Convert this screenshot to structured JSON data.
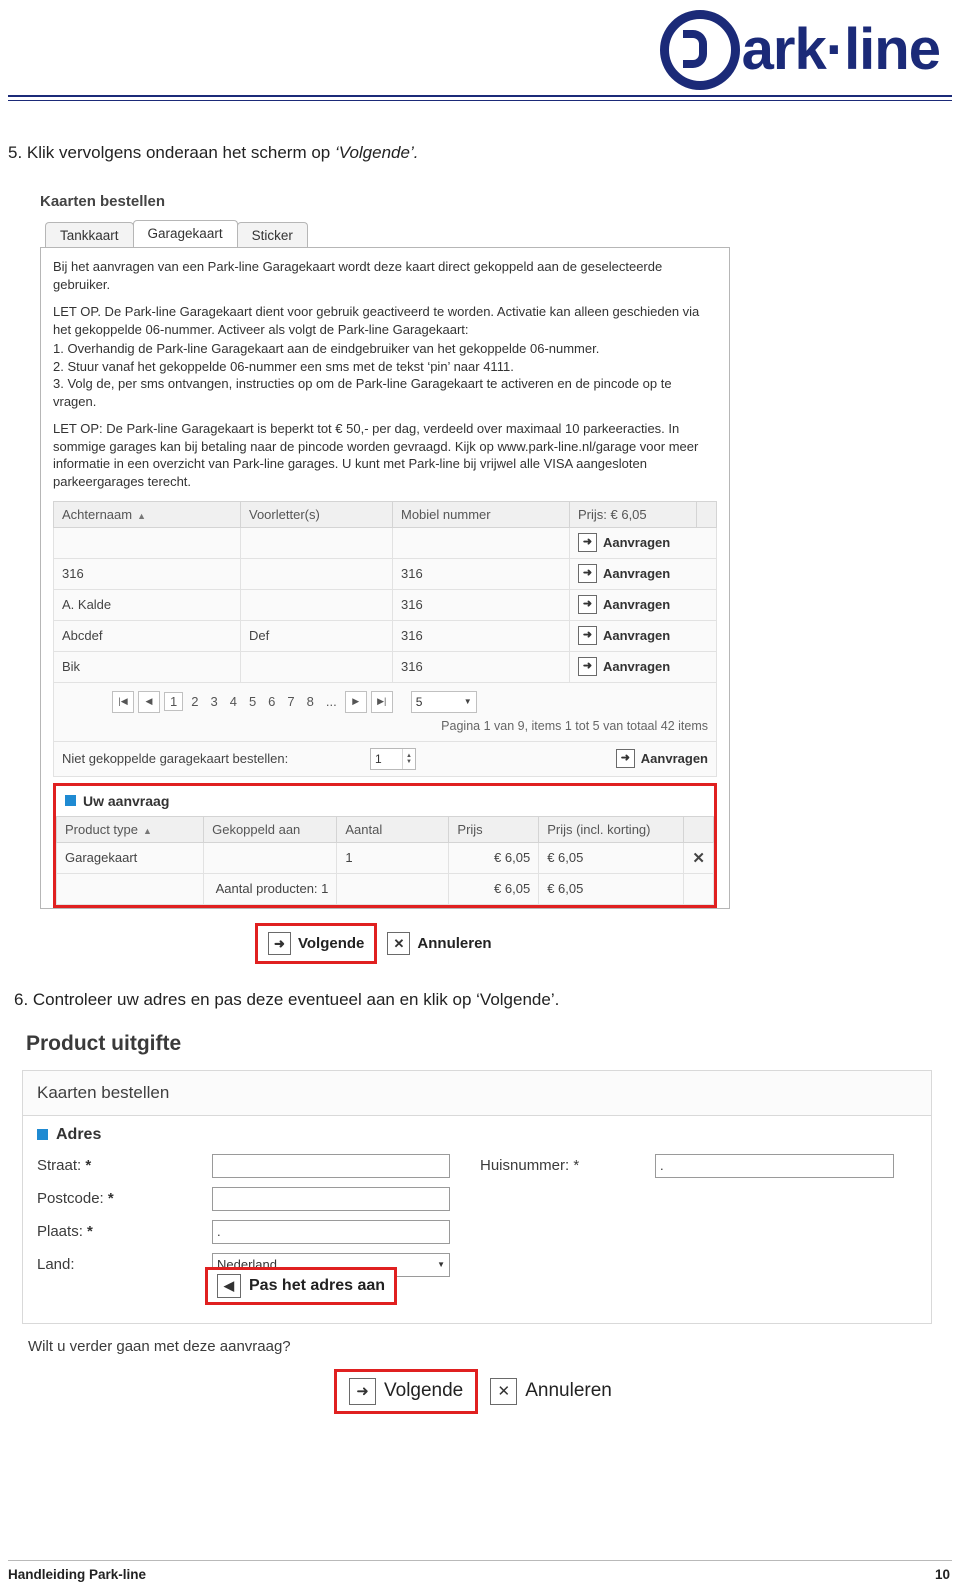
{
  "header": {
    "logo_text": "ark·line",
    "logo_letter": "P"
  },
  "steps": {
    "step5": "5. Klik vervolgens onderaan het scherm op ",
    "step5_italic": "‘Volgende’.",
    "step6": "6. Controleer uw adres en pas deze eventueel aan en klik op ",
    "step6_italic": "‘Volgende’."
  },
  "shot1": {
    "title": "Kaarten bestellen",
    "tabs": [
      {
        "label": "Tankkaart",
        "active": false
      },
      {
        "label": "Garagekaart",
        "active": true
      },
      {
        "label": "Sticker",
        "active": false
      }
    ],
    "paragraphs": [
      "Bij het aanvragen van een Park-line Garagekaart wordt deze kaart direct gekoppeld aan de geselecteerde gebruiker.",
      "LET OP. De Park-line Garagekaart dient voor gebruik geactiveerd te worden. Activatie kan alleen geschieden via het gekoppelde 06-nummer. Activeer als volgt de Park-line Garagekaart:"
    ],
    "numbered": [
      "1. Overhandig de Park-line Garagekaart aan de eindgebruiker van het gekoppelde 06-nummer.",
      "2. Stuur vanaf het gekoppelde 06-nummer een sms met de tekst ‘pin’ naar 4111.",
      "3. Volg de, per sms ontvangen, instructies op om de Park-line Garagekaart te activeren en de pincode op te vragen."
    ],
    "paragraph_last": "LET OP: De Park-line Garagekaart is beperkt tot € 50,- per dag, verdeeld over maximaal 10 parkeeracties. In sommige garages kan bij betaling naar de pincode worden gevraagd. Kijk op www.park-line.nl/garage voor meer informatie in een overzicht van Park-line garages. U kunt met Park-line bij vrijwel alle VISA aangesloten parkeergarages terecht.",
    "table": {
      "headers": [
        "Achternaam",
        "Voorletter(s)",
        "Mobiel nummer",
        "Prijs: € 6,05",
        ""
      ],
      "sort_column": "Achternaam",
      "rows": [
        {
          "achternaam": "",
          "voorletters": "",
          "mobiel": "",
          "action": "Aanvragen"
        },
        {
          "achternaam": "316",
          "voorletters": "",
          "mobiel": "316",
          "action": "Aanvragen"
        },
        {
          "achternaam": "A. Kaldе",
          "voorletters": "",
          "mobiel": "316",
          "action": "Aanvragen"
        },
        {
          "achternaam": "Abcdef",
          "voorletters": "Def",
          "mobiel": "316",
          "action": "Aanvragen"
        },
        {
          "achternaam": "Bik",
          "voorletters": "",
          "mobiel": "316",
          "action": "Aanvragen"
        }
      ]
    },
    "pager": {
      "first": "|◀",
      "prev": "◀",
      "pages": [
        "1",
        "2",
        "3",
        "4",
        "5",
        "6",
        "7",
        "8",
        "..."
      ],
      "current_page": "1",
      "next": "▶",
      "last": "▶|",
      "page_size": "5",
      "info": "Pagina 1 van 9, items 1 tot 5 van totaal 42 items"
    },
    "niet_gekoppeld": {
      "label": "Niet gekoppelde garagekaart bestellen:",
      "quantity": "1",
      "action": "Aanvragen"
    },
    "aanvraag": {
      "title": "Uw aanvraag",
      "headers": [
        "Product type",
        "Gekoppeld aan",
        "Aantal",
        "Prijs",
        "Prijs (incl. korting)",
        ""
      ],
      "row": {
        "product": "Garagekaart",
        "gekoppeld": "",
        "aantal": "1",
        "prijs": "€ 6,05",
        "prijs_korting": "€ 6,05",
        "remove": "✕"
      },
      "total": {
        "label": "Aantal producten: 1",
        "prijs": "€ 6,05",
        "prijs_korting": "€ 6,05"
      }
    },
    "buttons": {
      "next": "Volgende",
      "cancel": "Annuleren"
    }
  },
  "shot2": {
    "title": "Product uitgifte",
    "bar": "Kaarten bestellen",
    "section": "Adres",
    "fields": {
      "straat_label": "Straat:",
      "straat_value": "",
      "huisnummer_label": "Huisnummer:",
      "huisnummer_value": ".",
      "postcode_label": "Postcode:",
      "postcode_value": "",
      "plaats_label": "Plaats:",
      "plaats_value": ".",
      "land_label": "Land:",
      "land_value": "Nederland"
    },
    "adjust_button": "Pas het adres aan",
    "question": "Wilt u verder gaan met deze aanvraag?",
    "buttons": {
      "next": "Volgende",
      "cancel": "Annuleren"
    }
  },
  "footer": {
    "left": "Handleiding Park-line",
    "right": "10"
  },
  "colors": {
    "brand": "#1b2a78",
    "highlight": "#e02020",
    "accent_blue": "#1f8ad2"
  }
}
